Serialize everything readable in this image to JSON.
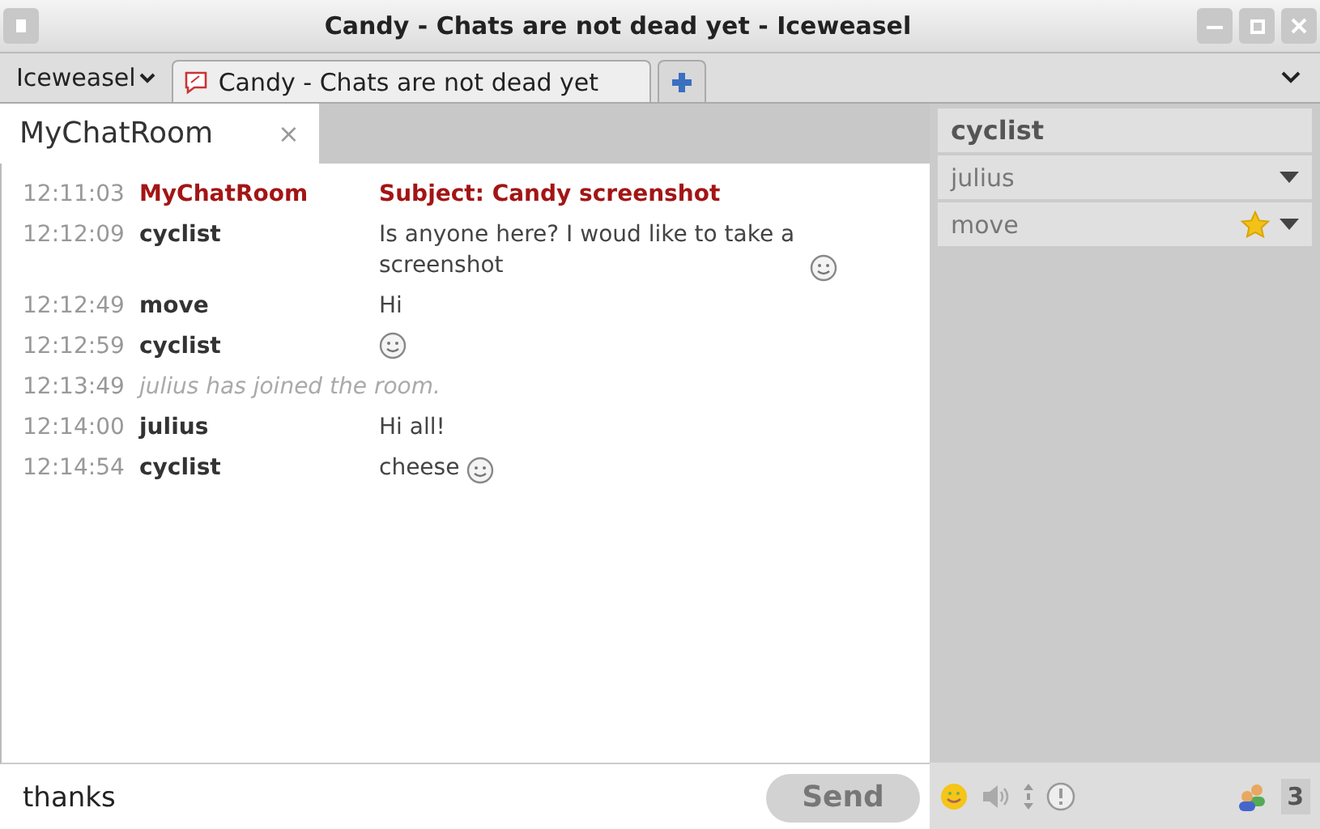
{
  "window": {
    "title": "Candy - Chats are not dead yet - Iceweasel"
  },
  "browser": {
    "menu": "Iceweasel",
    "tabs": [
      {
        "label": "Candy - Chats are not dead yet",
        "selected": true
      }
    ]
  },
  "room_tabs": [
    {
      "label": "MyChatRoom",
      "close": "×",
      "selected": true
    }
  ],
  "messages": [
    {
      "kind": "subject",
      "time": "12:11:03",
      "name": "MyChatRoom",
      "text": "Subject: Candy screenshot"
    },
    {
      "kind": "message",
      "time": "12:12:09",
      "name": "cyclist",
      "text": "Is anyone here? I woud like to take a screenshot",
      "smiley": true
    },
    {
      "kind": "message",
      "time": "12:12:49",
      "name": "move",
      "text": "Hi",
      "smiley": false
    },
    {
      "kind": "message",
      "time": "12:12:59",
      "name": "cyclist",
      "smiley": true
    },
    {
      "kind": "info",
      "time": "12:13:49",
      "text": "julius has joined the room."
    },
    {
      "kind": "message",
      "time": "12:14:00",
      "name": "julius",
      "text": "Hi all!",
      "smiley": false
    },
    {
      "kind": "message",
      "time": "12:14:54",
      "name": "cyclist",
      "text": "cheese",
      "smiley": true
    }
  ],
  "roster": [
    {
      "name": "cyclist",
      "self": true,
      "moderator": false
    },
    {
      "name": "julius",
      "self": false,
      "moderator": false
    },
    {
      "name": "move",
      "self": false,
      "moderator": true
    }
  ],
  "form": {
    "value": "thanks",
    "send": "Send"
  },
  "usercount": "3"
}
